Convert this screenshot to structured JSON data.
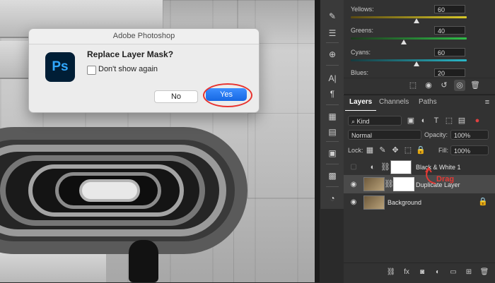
{
  "dialog": {
    "title": "Adobe Photoshop",
    "logo": "Ps",
    "message": "Replace Layer Mask?",
    "checkbox_label": "Don't show again",
    "no_label": "No",
    "yes_label": "Yes"
  },
  "properties": {
    "sliders": [
      {
        "label": "Yellows:",
        "value": "60",
        "color": "#d8c829"
      },
      {
        "label": "Greens:",
        "value": "40",
        "color": "#2fbe48"
      },
      {
        "label": "Cyans:",
        "value": "60",
        "color": "#2ab7c8"
      },
      {
        "label": "Blues:",
        "value": "20",
        "color": "#3d6bde"
      }
    ]
  },
  "layers_panel": {
    "tabs": [
      "Layers",
      "Channels",
      "Paths"
    ],
    "filter_label": "Kind",
    "blend_mode": "Normal",
    "opacity_label": "Opacity:",
    "opacity_value": "100%",
    "lock_label": "Lock:",
    "fill_label": "Fill:",
    "fill_value": "100%",
    "layers": [
      {
        "name": "Black & White 1"
      },
      {
        "name": "Duplicate Layer"
      },
      {
        "name": "Background"
      }
    ],
    "annotation": "Drag"
  },
  "colors": {
    "accent": "#1668e3",
    "highlight": "#e8332f"
  }
}
